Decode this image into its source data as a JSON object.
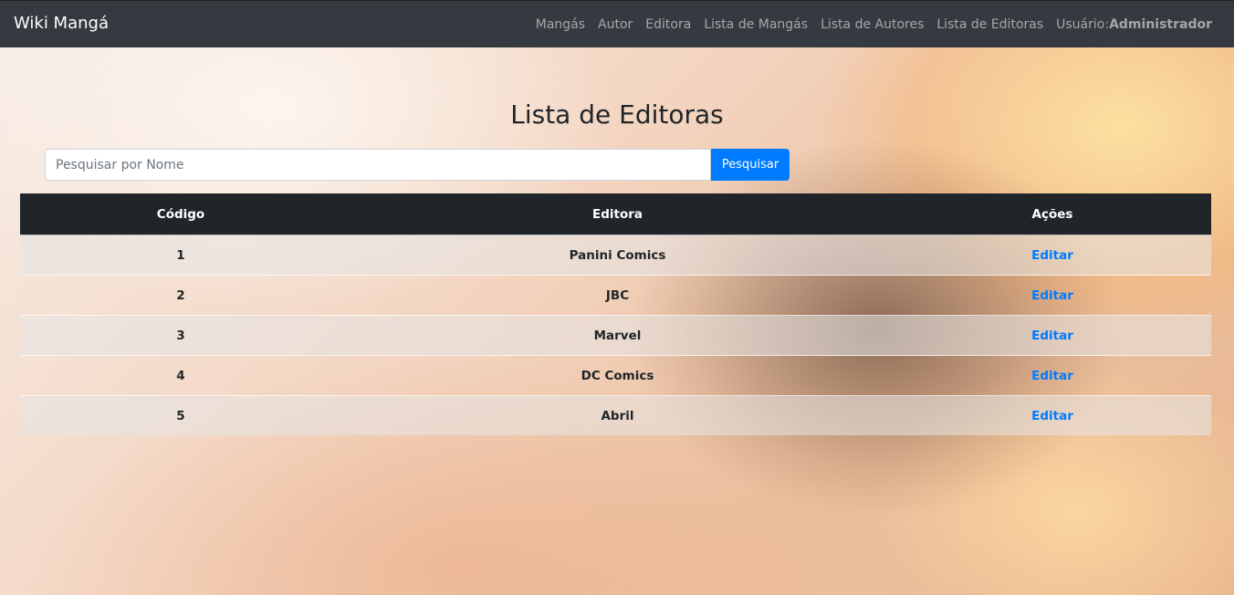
{
  "navbar": {
    "brand": "Wiki Mangá",
    "links": [
      {
        "label": "Mangás"
      },
      {
        "label": "Autor"
      },
      {
        "label": "Editora"
      },
      {
        "label": "Lista de Mangás"
      },
      {
        "label": "Lista de Autores"
      },
      {
        "label": "Lista de Editoras"
      }
    ],
    "user_prefix": "Usuário:",
    "user_name": "Administrador"
  },
  "page": {
    "title": "Lista de Editoras"
  },
  "search": {
    "placeholder": "Pesquisar por Nome",
    "value": "",
    "button_label": "Pesquisar"
  },
  "table": {
    "headers": [
      "Código",
      "Editora",
      "Ações"
    ],
    "rows": [
      {
        "code": "1",
        "publisher": "Panini Comics",
        "action": "Editar"
      },
      {
        "code": "2",
        "publisher": "JBC",
        "action": "Editar"
      },
      {
        "code": "3",
        "publisher": "Marvel",
        "action": "Editar"
      },
      {
        "code": "4",
        "publisher": "DC Comics",
        "action": "Editar"
      },
      {
        "code": "5",
        "publisher": "Abril",
        "action": "Editar"
      }
    ]
  },
  "colors": {
    "navbar_bg": "#343a40",
    "primary": "#007bff",
    "table_header_bg": "#212529"
  }
}
